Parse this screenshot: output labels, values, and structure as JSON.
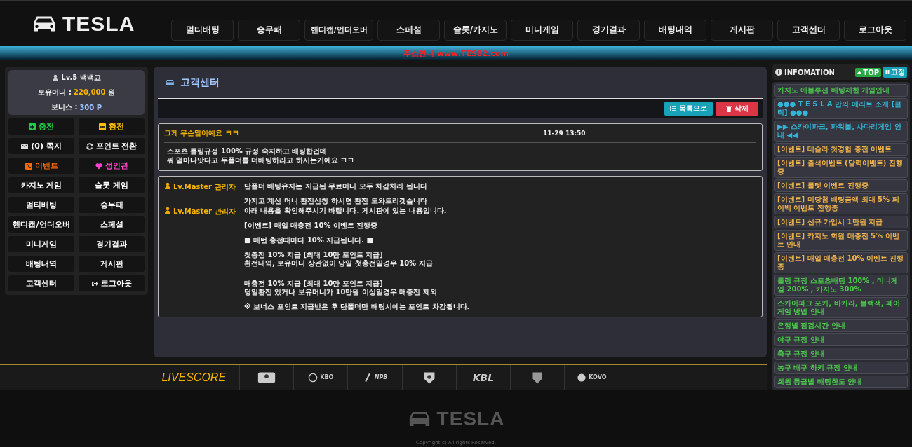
{
  "logo": {
    "text": "TESLA"
  },
  "nav": [
    "멀티배팅",
    "승무패",
    "핸디캡/언더오버",
    "스페셜",
    "슬롯/카지노",
    "미니게임",
    "경기결과",
    "배팅내역",
    "게시판",
    "고객센터",
    "로그아웃"
  ],
  "notice": "주소안내 www.TES82.com",
  "user": {
    "level": "Lv.5 백백교",
    "money_label": "보유머니 :",
    "money": "220,000",
    "money_unit": "원",
    "bonus_label": "보너스 :",
    "bonus": "300 P"
  },
  "side_buttons": [
    {
      "label": "충전",
      "kind": "plus",
      "color": "#22cc44"
    },
    {
      "label": "환전",
      "kind": "minus",
      "color": "#ffc107"
    },
    {
      "label": "(0) 쪽지",
      "kind": "mail",
      "color": "#ffffff"
    },
    {
      "label": "포인트 전환",
      "kind": "refresh",
      "color": "#ffffff"
    },
    {
      "label": "이벤트",
      "kind": "dice",
      "color": "#ff6a00"
    },
    {
      "label": "성인관",
      "kind": "heart",
      "color": "#ff44cc"
    },
    {
      "label": "카지노 게임",
      "kind": "plain",
      "color": "#ffffff"
    },
    {
      "label": "슬롯 게임",
      "kind": "plain",
      "color": "#ffffff"
    },
    {
      "label": "멀티배팅",
      "kind": "plain",
      "color": "#ffffff"
    },
    {
      "label": "승무패",
      "kind": "plain",
      "color": "#ffffff"
    },
    {
      "label": "핸디캡/언더오버",
      "kind": "plain",
      "color": "#ffffff"
    },
    {
      "label": "스페셜",
      "kind": "plain",
      "color": "#ffffff"
    },
    {
      "label": "미니게임",
      "kind": "plain",
      "color": "#ffffff"
    },
    {
      "label": "경기결과",
      "kind": "plain",
      "color": "#ffffff"
    },
    {
      "label": "배팅내역",
      "kind": "plain",
      "color": "#ffffff"
    },
    {
      "label": "게시판",
      "kind": "plain",
      "color": "#ffffff"
    },
    {
      "label": "고객센터",
      "kind": "plain",
      "color": "#ffffff"
    },
    {
      "label": "로그아웃",
      "kind": "logout",
      "color": "#ffffff"
    }
  ],
  "page_title": "고객센터",
  "actions": [
    {
      "label": "목록으로",
      "kind": "list"
    },
    {
      "label": "삭제",
      "kind": "delete"
    }
  ],
  "post": {
    "title": "그게 무슨말이예요 ㅋㅋ",
    "date": "11-29 13:50",
    "body": [
      "스포츠 롤링규정 100% 규정 숙지하고 배팅한건데",
      "뭐 얼마나맛다고 두폴더를 더배팅하라고 하시는거예요 ㅋㅋ"
    ]
  },
  "replies": [
    {
      "author": "Lv.Master 관리자",
      "paragraphs": [
        [
          "단폴더 배팅유지는 지급된 무료머니 모두 차감처리 됩니다"
        ],
        [
          "가지고 계신 머니 환전신청 하시면 환전 도와드리겟습니다"
        ]
      ]
    },
    {
      "author": "Lv.Master 관리자",
      "paragraphs": [
        [
          "아래 내용을 확인해주시기 바랍니다. 게시판에 있는 내용입니다."
        ],
        [
          "[이벤트] 매일 매충전 10% 이벤트 진행중"
        ],
        [
          "■ 매번 충전때마다 10% 지급됩니다. ■"
        ],
        [
          "첫충전 10% 지급 [최대 10만 포인트 지급]",
          "환전내역, 보유머니 상관없이 당일 첫충전일경우 10% 지급"
        ],
        [
          "매충전 10% 지급 [최대 10만 포인트 지급]",
          "당일환전 있거나 보유머니가 10만원 이상일경우 매충전 제외"
        ],
        [
          "※ 보너스 포인트 지급받은 후 단폴더만 배팅시에는 포인트 차감됩니다."
        ]
      ]
    }
  ],
  "info": {
    "title": "INFOMATION",
    "top": "TOP",
    "fix": "고정",
    "items": [
      {
        "text": "카지노 에볼루션 배팅제한 게임안내",
        "color": "#4cc94c"
      },
      {
        "text": "●●● T E S L A 만의 메리트 소개 [클릭] ●●●",
        "color": "#33b5d6"
      },
      {
        "text": "▶▶ 스카이파크, 파워볼, 사다리게임 안내 ◀◀",
        "color": "#33b5d6"
      },
      {
        "text": "[이벤트] 테슬라 첫경험 충전 이벤트",
        "color": "#f0b44c"
      },
      {
        "text": "[이벤트] 출석이벤트 (달력이벤트) 진행중",
        "color": "#f0b44c"
      },
      {
        "text": "[이벤트] 룰렛 이벤트 진행중",
        "color": "#f0b44c"
      },
      {
        "text": "[이벤트] 미당첨 배팅금액 최대 5% 페이백 이벤트 진행중",
        "color": "#f0b44c"
      },
      {
        "text": "[이벤트] 신규 가입시 1만원 지급",
        "color": "#f0b44c"
      },
      {
        "text": "[이벤트] 카지노 회원 매충전 5% 이벤트 안내",
        "color": "#f0b44c"
      },
      {
        "text": "[이벤트] 매일 매충전 10% 이벤트 진행중",
        "color": "#f0b44c"
      },
      {
        "text": "롤링 규정 스포츠배팅 100% , 미니게임 200% , 카지노 300%",
        "color": "#4cc94c"
      },
      {
        "text": "스카이파크 포커, 바카라, 블랙잭, 페어 게임 방법 안내",
        "color": "#4cc94c"
      },
      {
        "text": "은행별 점검시간 안내",
        "color": "#4cc94c"
      },
      {
        "text": "야구 규정 안내",
        "color": "#4cc94c"
      },
      {
        "text": "축구 규정 안내",
        "color": "#4cc94c"
      },
      {
        "text": "농구 배구 하키 규정 안내",
        "color": "#4cc94c"
      },
      {
        "text": "회원 등급별 배팅한도 안내",
        "color": "#4cc94c"
      }
    ]
  },
  "scores": [
    {
      "kind": "livescore",
      "label": "LIVESCORE"
    },
    {
      "kind": "baseball"
    },
    {
      "kind": "kbo",
      "label": "KBO"
    },
    {
      "kind": "npb",
      "label": "NPB"
    },
    {
      "kind": "shield"
    },
    {
      "kind": "kbl",
      "label": "KBL"
    },
    {
      "kind": "hockey"
    },
    {
      "kind": "kovo",
      "label": "KOVO"
    }
  ],
  "footer": {
    "logo": "TESLA",
    "copyright": "Copyright(c) All rights Reserved."
  }
}
